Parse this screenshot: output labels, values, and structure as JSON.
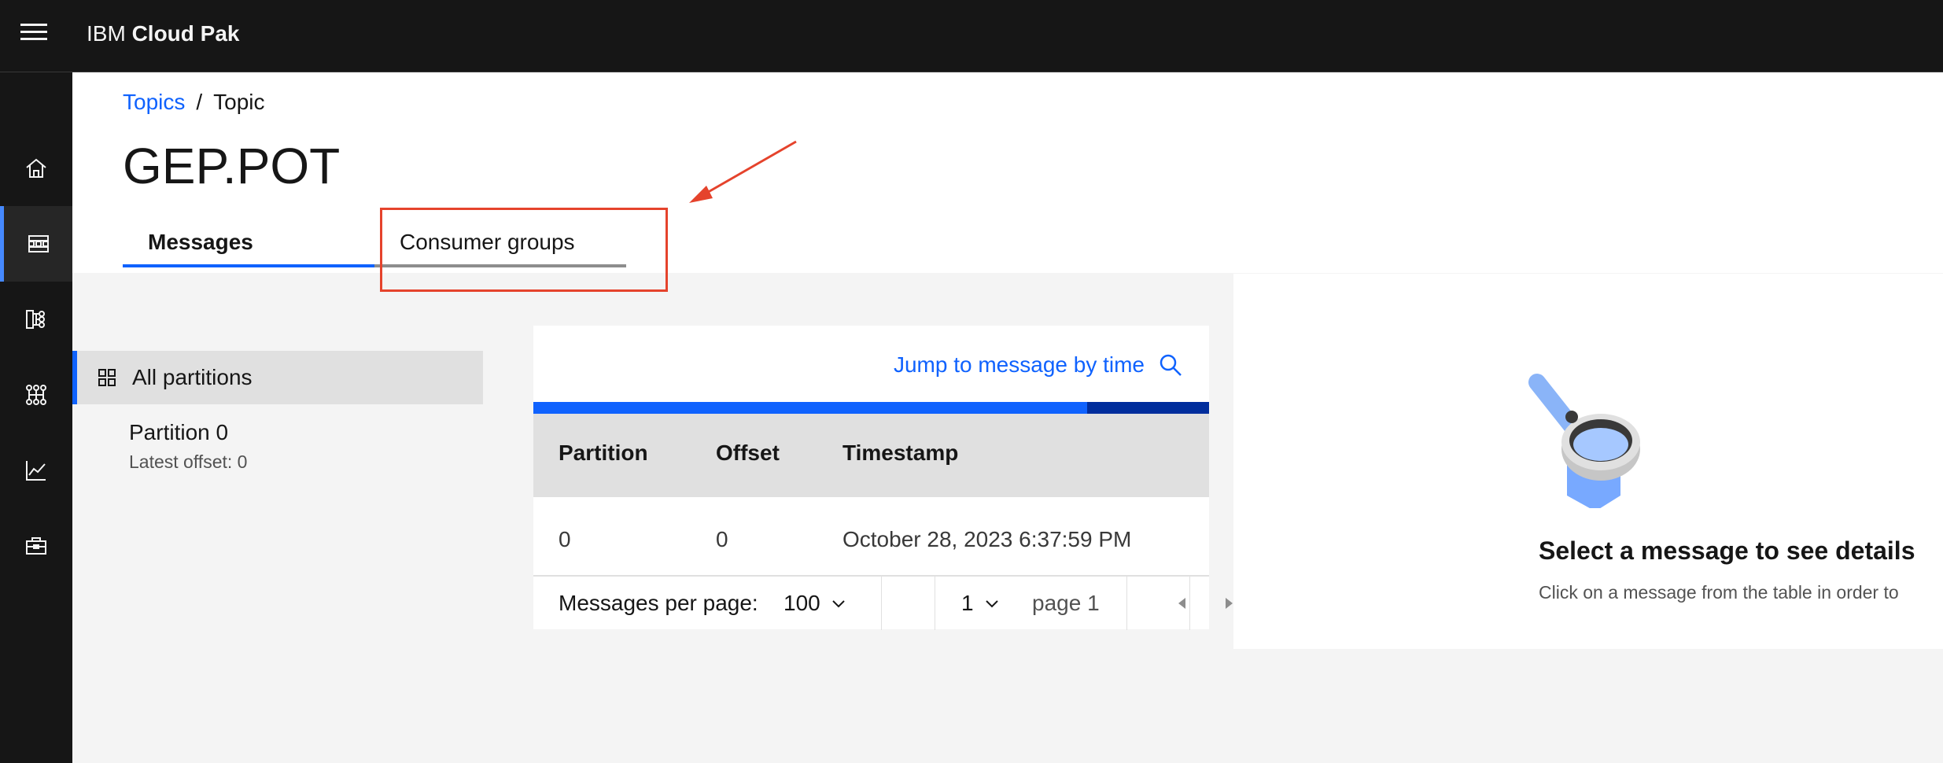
{
  "header": {
    "brand_prefix": "IBM",
    "brand_name": "Cloud Pak"
  },
  "sidenav": {
    "items": [
      {
        "icon": "home-icon",
        "active": false
      },
      {
        "icon": "topics-icon",
        "active": true
      },
      {
        "icon": "schemas-icon",
        "active": false
      },
      {
        "icon": "consumer-groups-icon",
        "active": false
      },
      {
        "icon": "monitoring-icon",
        "active": false
      },
      {
        "icon": "toolbox-icon",
        "active": false
      }
    ]
  },
  "breadcrumb": {
    "link": "Topics",
    "separator": "/",
    "current": "Topic"
  },
  "page": {
    "title": "GEP.POT"
  },
  "tabs": [
    {
      "label": "Messages",
      "selected": true
    },
    {
      "label": "Consumer groups",
      "selected": false
    }
  ],
  "partitions": {
    "all_label": "All partitions",
    "items": [
      {
        "name": "Partition 0",
        "latest_offset": "Latest offset: 0"
      }
    ]
  },
  "messages": {
    "jump_link": "Jump to message by time",
    "progress_fraction": 0.82,
    "columns": [
      "Partition",
      "Offset",
      "Timestamp"
    ],
    "rows": [
      {
        "partition": "0",
        "offset": "0",
        "timestamp": "October 28, 2023 6:37:59 PM"
      }
    ],
    "pagination": {
      "per_page_label": "Messages per page:",
      "per_page_value": "100",
      "page_value": "1",
      "page_label": "page 1"
    }
  },
  "detail": {
    "title": "Select a message to see details",
    "description": "Click on a message from the table in order to"
  },
  "colors": {
    "header_bg": "#161616",
    "accent_blue": "#0f62fe",
    "annotation_red": "#e5432c"
  }
}
